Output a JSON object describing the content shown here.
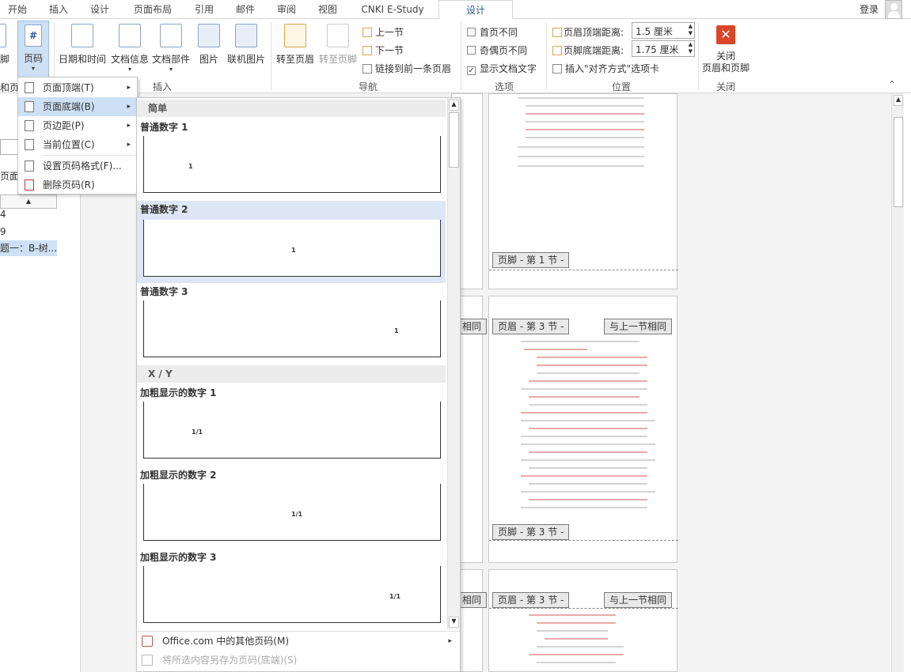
{
  "tabs": [
    "开始",
    "插入",
    "设计",
    "页面布局",
    "引用",
    "邮件",
    "审阅",
    "视图",
    "CNKI E-Study",
    "设计"
  ],
  "login": "登录",
  "ribbon": {
    "left_cut_top": "脚",
    "left_cut_bottom": "和页脚",
    "page_number": "页码",
    "date_time": "日期和时间",
    "doc_info": "文档信息",
    "doc_parts": "文档部件",
    "picture": "图片",
    "online_picture": "联机图片",
    "goto_header": "转至页眉",
    "goto_footer": "转至页脚",
    "prev_section": "上一节",
    "next_section": "下一节",
    "link_prev": "链接到前一条页眉",
    "first_page_diff": "首页不同",
    "odd_even_diff": "奇偶页不同",
    "show_doc_text": "显示文档文字",
    "header_top_label": "页眉顶端距离:",
    "header_top_value": "1.5 厘米",
    "footer_bottom_label": "页脚底端距离:",
    "footer_bottom_value": "1.75 厘米",
    "insert_align_tab": "插入\"对齐方式\"选项卡",
    "close_line1": "关闭",
    "close_line2": "页眉和页脚",
    "group_insert": "插入",
    "group_nav": "导航",
    "group_options": "选项",
    "group_position": "位置",
    "group_close": "关闭"
  },
  "left_pane": {
    "label": "页面",
    "item1": "4",
    "item2": "9",
    "selected": "题一：B-树..."
  },
  "menu": {
    "items": [
      {
        "label": "页面顶端(T)",
        "arrow": "▸"
      },
      {
        "label": "页面底端(B)",
        "arrow": "▸"
      },
      {
        "label": "页边距(P)",
        "arrow": "▸"
      },
      {
        "label": "当前位置(C)",
        "arrow": "▸"
      },
      {
        "label": "设置页码格式(F)..."
      },
      {
        "label": "删除页码(R)"
      }
    ]
  },
  "gallery": {
    "section1": "简单",
    "section2": "X / Y",
    "items": [
      "普通数字 1",
      "普通数字 2",
      "普通数字 3",
      "加粗显示的数字 1",
      "加粗显示的数字 2",
      "加粗显示的数字 3"
    ],
    "mark_simple": "1",
    "mark_xy": "1/1",
    "more": "Office.com 中的其他页码(M)",
    "save": "将所选内容另存为页码(底端)(S)"
  },
  "pages": {
    "footer1": "页脚 - 第 1 节 -",
    "header3": "页眉 - 第 3 节 -",
    "same_as_prev": "与上一节相同",
    "footer3": "页脚 - 第 3 节 -",
    "same_cut": "相同"
  },
  "colors": {
    "accent": "#2b579a",
    "highlight": "#cde0f4",
    "close_red": "#d9472b"
  }
}
